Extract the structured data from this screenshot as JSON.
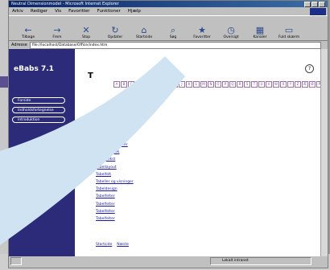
{
  "window": {
    "title": "Neutral Dimensionmodel - Microsoft Internet Explorer",
    "menu": [
      "Arkiv",
      "Rediger",
      "Vis",
      "Favoritter",
      "Funktioner",
      "Hjælp"
    ]
  },
  "toolbar": {
    "buttons": [
      {
        "label": "Tilbage",
        "icon": "back-arrow-icon"
      },
      {
        "label": "Frem",
        "icon": "forward-arrow-icon"
      },
      {
        "label": "Stop",
        "icon": "stop-icon"
      },
      {
        "label": "Opdater",
        "icon": "refresh-icon"
      },
      {
        "label": "Startside",
        "icon": "home-icon"
      },
      {
        "label": "Søg",
        "icon": "search-icon"
      },
      {
        "label": "Favoritter",
        "icon": "favorites-icon"
      },
      {
        "label": "Oversigt",
        "icon": "history-icon"
      },
      {
        "label": "Kanaler",
        "icon": "channels-icon"
      },
      {
        "label": "Fuld skærm",
        "icon": "fullscreen-icon"
      }
    ]
  },
  "address": {
    "label": "Adresse",
    "value": "file://localhost/Database/Office/index.htm"
  },
  "sidebar": {
    "title": "eBabs 7.1",
    "items": [
      "Forside",
      "Indholdsfortegnelse",
      "Introduktion"
    ]
  },
  "main": {
    "heading": "T",
    "letters": [
      "A",
      "B",
      "C",
      "D",
      "E",
      "F",
      "G",
      "H",
      "I",
      "J",
      "K",
      "L",
      "M",
      "N",
      "O",
      "P",
      "Q",
      "R",
      "S",
      "T",
      "U",
      "V",
      "W",
      "X",
      "Y",
      "Z",
      "Æ",
      "Ø",
      "Å"
    ],
    "links": [
      "Tabeller og grafer",
      "Tabel udtræk",
      "Tabel tekst",
      "Tabellayout",
      "Tabelfelt",
      "Tabeller og visninger",
      "Tabeldesign",
      "Tabelfelter",
      "Tabelfelter",
      "Tabelfelter",
      "Tabelfelter"
    ],
    "footer_links": [
      "Startside",
      "Næste"
    ]
  },
  "status": {
    "zone": "Lokalt intranet"
  },
  "colors": {
    "sidebar": "#2b2b7a",
    "link": "#1a1aaa",
    "titlebar": "#0a246a"
  }
}
